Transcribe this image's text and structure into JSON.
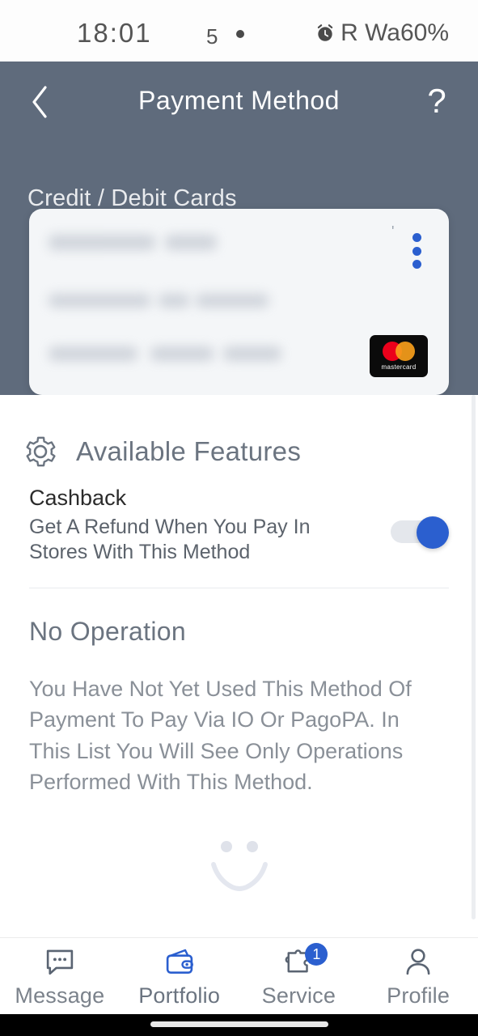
{
  "status_bar": {
    "time": "18:01",
    "extra": "5",
    "alarm_icon": "alarm-clock-icon",
    "battery": "R Wa60%"
  },
  "header": {
    "title": "Payment Method",
    "back_icon": "chevron-left-icon",
    "help_icon": "question-mark-icon",
    "background_color": "#5f6b7c",
    "section_label": "Credit / Debit Cards"
  },
  "card": {
    "menu_icon": "kebab-menu-icon",
    "menu_color": "#2b5fcf",
    "brand_logo": "mastercard-logo",
    "brand_name": "mastercard",
    "tiny_mark": "'",
    "redacted": true
  },
  "features": {
    "icon": "gear-icon",
    "title": "Available Features",
    "items": [
      {
        "title": "Cashback",
        "description": "Get A Refund When You Pay In Stores With This Method",
        "toggle_name": "cashback-toggle",
        "toggle_on": true,
        "toggle_color": "#2b5fcf"
      }
    ]
  },
  "operations": {
    "title": "No Operation",
    "body": "You Have Not Yet Used This Method Of Payment To Pay Via IO Or PagoPA. In This List You Will See Only Operations Performed With This Method.",
    "illustration": "smiley-face-icon"
  },
  "bottom_nav": {
    "items": [
      {
        "label": "Message",
        "icon": "chat-bubble-icon",
        "active": false,
        "badge": ""
      },
      {
        "label": "Portfolio",
        "icon": "wallet-icon",
        "active": true,
        "badge": ""
      },
      {
        "label": "Service",
        "icon": "puzzle-piece-icon",
        "active": false,
        "badge": "1"
      },
      {
        "label": "Profile",
        "icon": "person-icon",
        "active": false,
        "badge": ""
      }
    ]
  }
}
